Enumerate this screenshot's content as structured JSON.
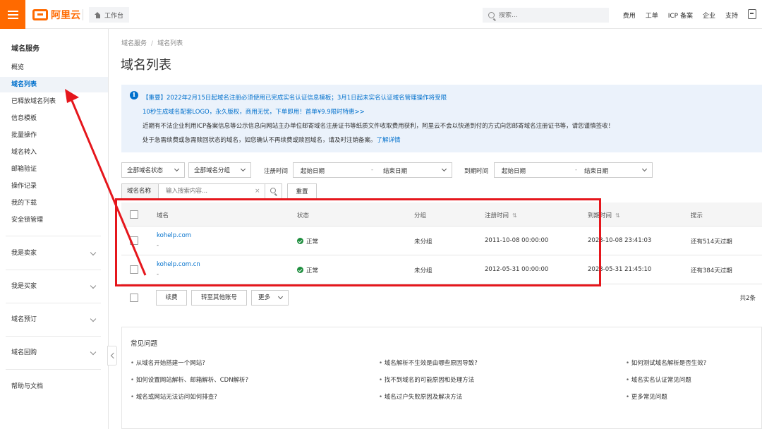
{
  "topbar": {
    "logo_text": "阿里云",
    "workbench": "工作台",
    "search_placeholder": "搜索...",
    "links": [
      "费用",
      "工单",
      "ICP 备案",
      "企业",
      "支持"
    ],
    "brand_color": "#ff6a00"
  },
  "sidebar": {
    "title": "域名服务",
    "items": [
      "概览",
      "域名列表",
      "已释放域名列表",
      "信息模板",
      "批量操作",
      "域名转入",
      "邮箱验证",
      "操作记录",
      "我的下载",
      "安全锁管理"
    ],
    "active_index": 1,
    "groups": [
      "我是卖家",
      "我是买家",
      "域名预订",
      "域名回购"
    ],
    "footer": "帮助与文档"
  },
  "breadcrumb": [
    "域名服务",
    "域名列表"
  ],
  "page_title": "域名列表",
  "notice": {
    "line1": "【重要】2022年2月15日起域名注册必须使用已完成实名认证信息模板；3月1日起未实名认证域名管理操作将受限",
    "line2": "10秒生成域名配套LOGO，永久版权，商用无忧，下单即用！首单¥9.9限时特惠>>",
    "line3": "近期有不法企业利用ICP备案信息等公示信息向网站主办单位邮寄域名注册证书等纸质文件收取费用获利，阿里云不会以快递到付的方式向您邮寄域名注册证书等，请您谨慎签收！",
    "line4": "处于急需续费或急需赎回状态的域名，如您确认不再续费或赎回域名，请及时注销备案。",
    "line4_link": "了解详情"
  },
  "filters": {
    "status_select": "全部域名状态",
    "group_select": "全部域名分组",
    "reg_time_label": "注册时间",
    "exp_time_label": "到期时间",
    "start_date": "起始日期",
    "end_date": "结束日期",
    "dash": "-",
    "name_label": "域名名称",
    "name_placeholder": "输入搜索内容...",
    "clear": "×",
    "reset": "重置"
  },
  "table": {
    "headers": {
      "domain": "域名",
      "status": "状态",
      "group": "分组",
      "reg_time": "注册时间",
      "exp_time": "到期时间",
      "hint": "提示"
    },
    "sort_icon": "⇅",
    "rows": [
      {
        "domain": "kohelp.com",
        "sub": "-",
        "status": "正常",
        "group": "未分组",
        "reg_time": "2011-10-08 00:00:00",
        "exp_time": "2023-10-08 23:41:03",
        "hint": "还有514天过期"
      },
      {
        "domain": "kohelp.com.cn",
        "sub": "-",
        "status": "正常",
        "group": "未分组",
        "reg_time": "2012-05-31 00:00:00",
        "exp_time": "2023-05-31 21:45:10",
        "hint": "还有384天过期"
      }
    ]
  },
  "bulk_actions": {
    "renew": "续费",
    "transfer": "转至其他账号",
    "more": "更多",
    "total": "共2条"
  },
  "faq": {
    "title": "常见问题",
    "items": [
      "从域名开始搭建一个网站?",
      "如何设置网站解析、邮箱解析、CDN解析?",
      "域名或网站无法访问如何排查?",
      "域名解析不生效是由哪些原因导致?",
      "找不到域名的可能原因和处理方法",
      "域名过户失败原因及解决方法",
      "如何测试域名解析是否生效?",
      "域名实名认证常见问题",
      "更多常见问题"
    ]
  },
  "annotation_color": "#e5161c"
}
